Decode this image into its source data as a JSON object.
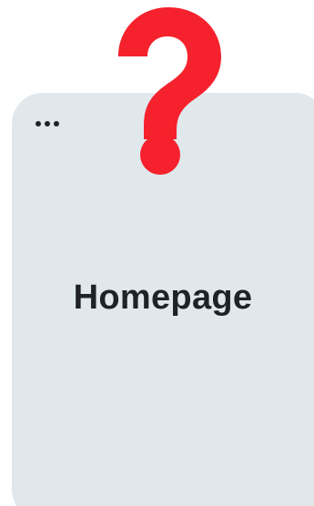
{
  "page": {
    "title": "Homepage"
  },
  "icons": {
    "menu": "more-horizontal-icon",
    "overlay": "question-mark-icon"
  },
  "colors": {
    "card_background": "#e1e8ec",
    "text": "#1f2328",
    "question_mark": "#f5222d"
  }
}
